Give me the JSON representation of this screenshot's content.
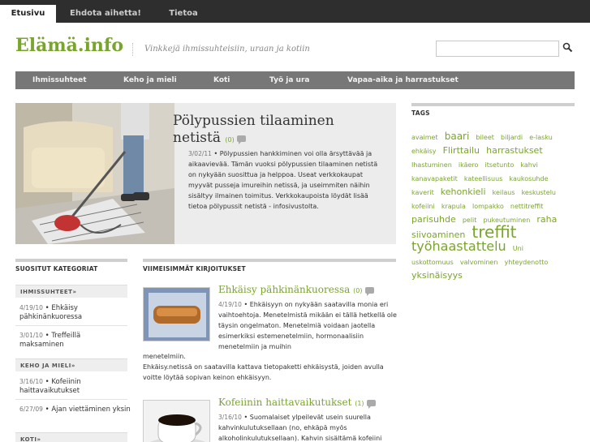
{
  "topnav": {
    "tabs": [
      {
        "label": "Etusivu",
        "active": true
      },
      {
        "label": "Ehdota aihetta!",
        "active": false
      },
      {
        "label": "Tietoa",
        "active": false
      }
    ]
  },
  "header": {
    "logo": "Elämä.info",
    "tagline": "Vinkkejä ihmissuhteisiin, uraan ja kotiin",
    "search_placeholder": "",
    "search_icon": "search-icon"
  },
  "mainnav": {
    "items": [
      "Ihmissuhteet",
      "Keho ja mieli",
      "Koti",
      "Työ ja ura",
      "Vapaa-aika ja harrastukset"
    ]
  },
  "featured": {
    "title": "Pölypussien tilaaminen netistä",
    "comments": "(0)",
    "date": "3/02/11",
    "text": "Pölypussien hankkiminen voi olla ärsyttävää ja aikaavievää. Tämän vuoksi pölypussien tilaaminen netistä on nykyään suosittua ja helppoa. Useat verkkokaupat myyvät pusseja imureihin netissä, ja useimmiten näihin sisältyy ilmainen toimitus. Verkkokaupoista löydät lisää tietoa pölypussit netistä - infosivustolta."
  },
  "sidebar": {
    "heading": "SUOSITUT KATEGORIAT",
    "groups": [
      {
        "title": "IHMISSUHTEET»",
        "links": [
          {
            "date": "4/19/10",
            "label": "Ehkäisy pähkinänkuoressa"
          },
          {
            "date": "3/01/10",
            "label": "Treffeillä maksaminen"
          }
        ]
      },
      {
        "title": "KEHO JA MIELI»",
        "links": [
          {
            "date": "3/16/10",
            "label": "Kofeiinin haittavaikutukset"
          },
          {
            "date": "6/27/09",
            "label": "Ajan viettäminen yksin"
          }
        ]
      },
      {
        "title": "KOTI»",
        "links": []
      }
    ]
  },
  "recent": {
    "heading": "VIIMEISIMMÄT KIRJOITUKSET",
    "posts": [
      {
        "title": "Ehkäisy pähkinänkuoressa",
        "comments": "(0)",
        "date": "4/19/10",
        "text": "Ehkäisyyn on nykyään saatavilla monia eri vaihtoehtoja. Menetelmistä mikään ei tällä hetkellä ole täysin ongelmaton. Menetelmiä voidaan jaotella esimerkiksi estemenetelmiin, hormonaalisiin menetelmiin ja muihin",
        "tail": "menetelmiin.",
        "extra": "Ehkäisy.netissä on saatavilla kattava tietopaketti ehkäisystä, joiden avulla voitte löytää sopivan keinon ehkäisyyn."
      },
      {
        "title": "Kofeiinin haittavaikutukset",
        "comments": "(1)",
        "date": "3/16/10",
        "text": "Suomalaiset ylpeilevät usein suurella kahvinkulutuksellaan (no, ehkäpä myös alkoholinkulutuksellaan). Kahvin sisältämä kofeiini"
      }
    ]
  },
  "tags": {
    "heading": "TAGS",
    "items": [
      {
        "label": "avaimet",
        "size": 8
      },
      {
        "label": "baari",
        "size": 12
      },
      {
        "label": "bileet",
        "size": 8
      },
      {
        "label": "biljardi",
        "size": 8
      },
      {
        "label": "e-lasku",
        "size": 8
      },
      {
        "label": "ehkäisy",
        "size": 8
      },
      {
        "label": "Flirttailu",
        "size": 11
      },
      {
        "label": "harrastukset",
        "size": 11
      },
      {
        "label": "Ihastuminen",
        "size": 8
      },
      {
        "label": "ikäero",
        "size": 8
      },
      {
        "label": "itsetunto",
        "size": 8
      },
      {
        "label": "kahvi",
        "size": 8
      },
      {
        "label": "kanavapaketit",
        "size": 8
      },
      {
        "label": "kateellisuus",
        "size": 8
      },
      {
        "label": "kaukosuhde",
        "size": 8
      },
      {
        "label": "kaverit",
        "size": 8
      },
      {
        "label": "kehonkieli",
        "size": 11
      },
      {
        "label": "keilaus",
        "size": 8
      },
      {
        "label": "keskustelu",
        "size": 8
      },
      {
        "label": "kofeiini",
        "size": 8
      },
      {
        "label": "krapula",
        "size": 8
      },
      {
        "label": "lompakko",
        "size": 8
      },
      {
        "label": "nettitreffit",
        "size": 8
      },
      {
        "label": "parisuhde",
        "size": 11
      },
      {
        "label": "pelit",
        "size": 8
      },
      {
        "label": "pukeutuminen",
        "size": 8
      },
      {
        "label": "raha",
        "size": 11
      },
      {
        "label": "siivoaminen",
        "size": 11
      },
      {
        "label": "treffit",
        "size": 20
      },
      {
        "label": "työhaastattelu",
        "size": 16
      },
      {
        "label": "Uni",
        "size": 8
      },
      {
        "label": "uskottomuus",
        "size": 8
      },
      {
        "label": "valvominen",
        "size": 8
      },
      {
        "label": "yhteydenotto",
        "size": 8
      },
      {
        "label": "yksinäisyys",
        "size": 11
      }
    ]
  }
}
